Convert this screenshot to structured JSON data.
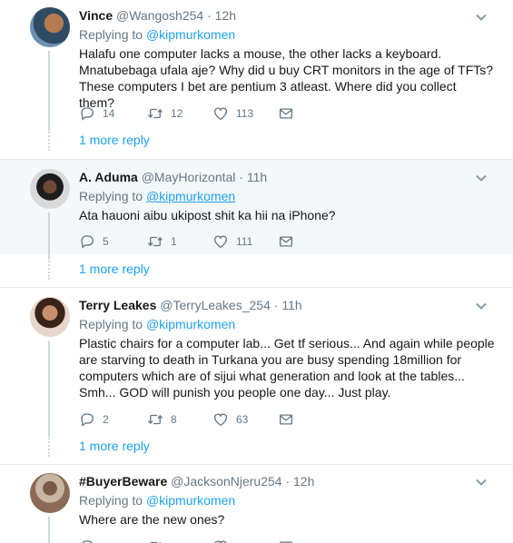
{
  "tweets": [
    {
      "name": "Vince",
      "handle": "@Wangosh254",
      "sep": "·",
      "time": "12h",
      "replying_prefix": "Replying to ",
      "replying_to": "@kipmurkomen",
      "text": "Halafu one computer lacks a mouse, the other lacks a keyboard. Mnatubebaga ufala aje? Why did u buy CRT monitors in the age of TFTs? These computers I bet are pentium 3 atleast. Where did you collect them?",
      "replies": "14",
      "retweets": "12",
      "likes": "113",
      "more_reply": "1 more reply"
    },
    {
      "name": "A. Aduma",
      "handle": "@MayHorizontal",
      "sep": "·",
      "time": "11h",
      "replying_prefix": "Replying to ",
      "replying_to": "@kipmurkomen",
      "text": "Ata hauoni aibu ukipost shit ka hii na iPhone?",
      "replies": "5",
      "retweets": "1",
      "likes": "111",
      "more_reply": "1 more reply"
    },
    {
      "name": "Terry Leakes",
      "handle": "@TerryLeakes_254",
      "sep": "·",
      "time": "11h",
      "replying_prefix": "Replying to ",
      "replying_to": "@kipmurkomen",
      "text": "Plastic chairs for a computer lab... Get tf serious... And again while people are starving to death in Turkana you are busy spending 18million for computers which are of sijui what generation and look at the tables... Smh... GOD will punish you people one day... Just play.",
      "replies": "2",
      "retweets": "8",
      "likes": "63",
      "more_reply": "1 more reply"
    },
    {
      "name": "#BuyerBeware",
      "handle": "@JacksonNjeru254",
      "sep": "·",
      "time": "12h",
      "replying_prefix": "Replying to ",
      "replying_to": "@kipmurkomen",
      "text": "Where are the new ones?"
    }
  ],
  "icons": {
    "reply": "reply-icon",
    "retweet": "retweet-icon",
    "like": "heart-icon",
    "message": "envelope-icon",
    "caret": "chevron-down-icon"
  },
  "colors": {
    "link": "#1da1f2",
    "muted": "#657786",
    "shaded_bg": "#f5f8fa"
  }
}
